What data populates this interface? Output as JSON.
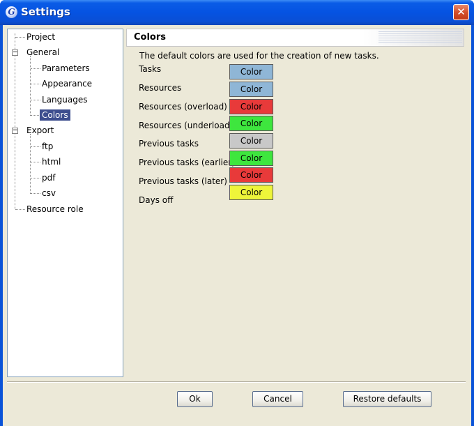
{
  "window": {
    "title": "Settings",
    "icon_glyph": "G",
    "close_glyph": "✕"
  },
  "tree": {
    "items": [
      {
        "label": "Project"
      },
      {
        "label": "General"
      },
      {
        "label": "Parameters"
      },
      {
        "label": "Appearance"
      },
      {
        "label": "Languages"
      },
      {
        "label": "Colors"
      },
      {
        "label": "Export"
      },
      {
        "label": "ftp"
      },
      {
        "label": "html"
      },
      {
        "label": "pdf"
      },
      {
        "label": "csv"
      },
      {
        "label": "Resource role"
      }
    ],
    "expanded_glyph": "−",
    "selected": "Colors"
  },
  "panel": {
    "title": "Colors",
    "description": "The default colors are used for the creation of new tasks.",
    "rows": [
      {
        "label": "Tasks",
        "button": "Color",
        "color": "#8fb6d6"
      },
      {
        "label": "Resources",
        "button": "Color",
        "color": "#8fb6d6"
      },
      {
        "label": "Resources (overload)",
        "button": "Color",
        "color": "#e83a3a"
      },
      {
        "label": "Resources (underload)",
        "button": "Color",
        "color": "#3ee63e"
      },
      {
        "label": "Previous tasks",
        "button": "Color",
        "color": "#c8c8c8"
      },
      {
        "label": "Previous tasks (earlier)",
        "button": "Color",
        "color": "#3ee63e"
      },
      {
        "label": "Previous tasks (later)",
        "button": "Color",
        "color": "#e83a3a"
      },
      {
        "label": "Days off",
        "button": "Color",
        "color": "#eef53a"
      }
    ]
  },
  "buttons": {
    "ok": "Ok",
    "cancel": "Cancel",
    "restore": "Restore defaults"
  }
}
